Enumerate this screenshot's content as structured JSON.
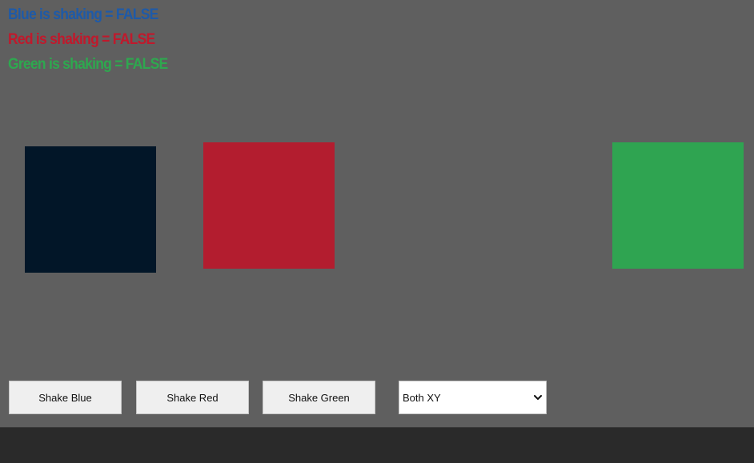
{
  "status": {
    "blue": "Blue is shaking = FALSE",
    "red": "Red is shaking = FALSE",
    "green": "Green is shaking = FALSE"
  },
  "colors": {
    "background": "#5f5f5f",
    "footer": "#2a2a2a",
    "blue_text": "#1e5aa8",
    "red_text": "#c0192c",
    "green_text": "#2ea84f",
    "blue_square": "#021628",
    "red_square": "#b31d2f",
    "green_square": "#2fa451"
  },
  "buttons": {
    "shake_blue": "Shake Blue",
    "shake_red": "Shake Red",
    "shake_green": "Shake Green"
  },
  "axis_select": {
    "selected": "Both XY",
    "icon": "chevron-down-icon"
  }
}
